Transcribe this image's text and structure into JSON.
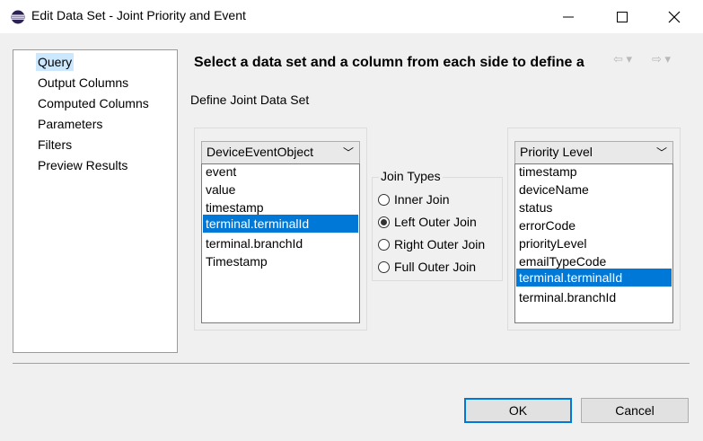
{
  "window": {
    "title": "Edit Data Set - Joint Priority and Event"
  },
  "nav": {
    "items": [
      {
        "label": "Query",
        "selected": true
      },
      {
        "label": "Output Columns",
        "selected": false
      },
      {
        "label": "Computed Columns",
        "selected": false
      },
      {
        "label": "Parameters",
        "selected": false
      },
      {
        "label": "Filters",
        "selected": false
      },
      {
        "label": "Preview Results",
        "selected": false
      }
    ]
  },
  "header": {
    "text": "Select a data set and a column from each side to define a"
  },
  "main": {
    "define_label": "Define Joint Data Set",
    "left": {
      "dataset": "DeviceEventObject",
      "columns": [
        "event",
        "value",
        "timestamp",
        "terminal.terminalId",
        "terminal.branchId",
        "Timestamp"
      ],
      "selected_index": 3
    },
    "join_types": {
      "label": "Join Types",
      "options": [
        "Inner Join",
        "Left Outer Join",
        "Right Outer Join",
        "Full Outer Join"
      ],
      "selected_index": 1
    },
    "right": {
      "dataset": "Priority Level",
      "columns": [
        "timestamp",
        "deviceName",
        "status",
        "errorCode",
        "priorityLevel",
        "emailTypeCode",
        "terminal.terminalId",
        "terminal.branchId"
      ],
      "selected_index": 6
    }
  },
  "buttons": {
    "ok": "OK",
    "cancel": "Cancel"
  },
  "colors": {
    "selection": "#0078d7",
    "nav_selection": "#cce8ff"
  }
}
